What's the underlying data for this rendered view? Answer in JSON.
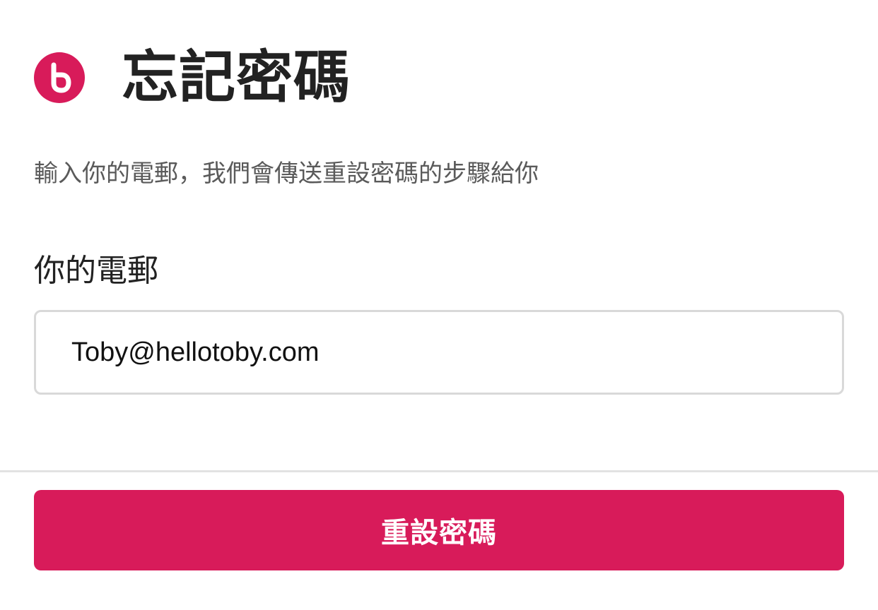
{
  "brand": {
    "logo_icon": "toby-logo-icon",
    "accent_color": "#d81b5a"
  },
  "header": {
    "title": "忘記密碼"
  },
  "subtitle": "輸入你的電郵，我們會傳送重設密碼的步驟給你",
  "form": {
    "email_label": "你的電郵",
    "email_value": "Toby@hellotoby.com"
  },
  "footer": {
    "reset_button_label": "重設密碼"
  }
}
